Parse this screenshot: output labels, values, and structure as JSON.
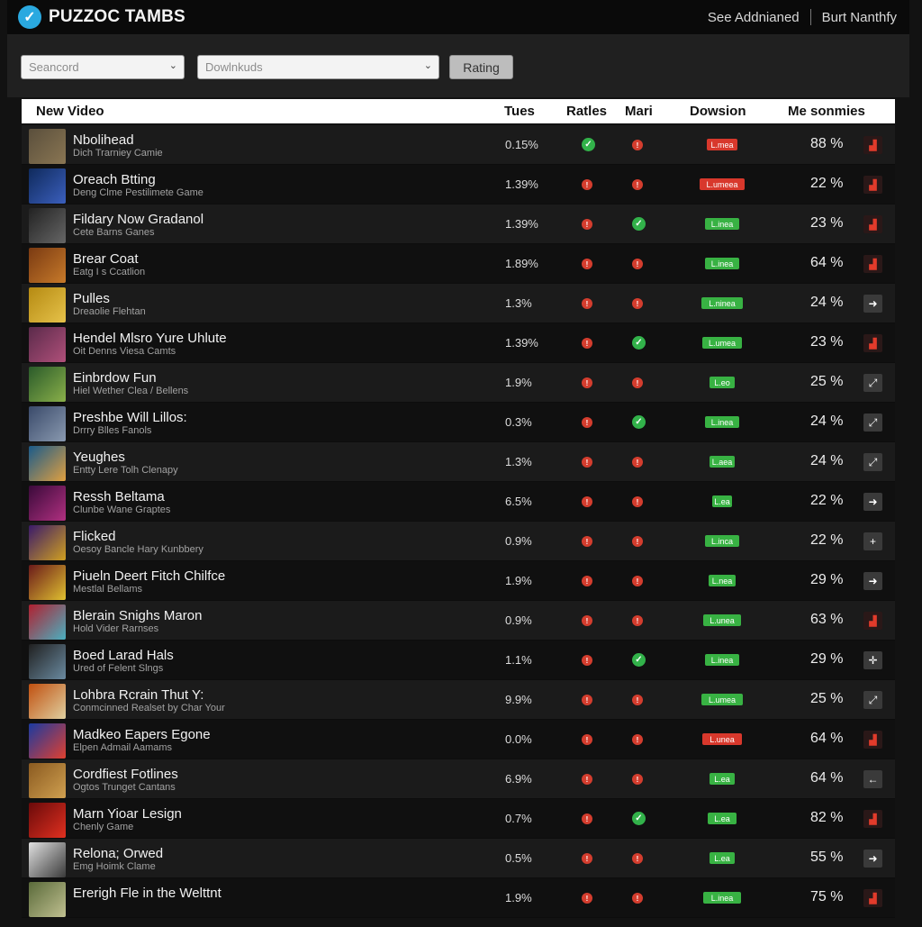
{
  "header": {
    "logo_icon": "check-badge-icon",
    "title": "PUZZOC TAMBS",
    "link_left": "See Addnianed",
    "link_right": "Burt Nanthfy"
  },
  "filters": {
    "search_value": "Seancord",
    "downloads_value": "Dowlnkuds",
    "rating_label": "Rating"
  },
  "columns": {
    "name": "New Video",
    "tues": "Tues",
    "ratles": "Ratles",
    "mari": "Mari",
    "dowsion": "Dowsion",
    "me": "Me sonmies"
  },
  "colors": {
    "accent": "#2aa9e0",
    "good": "#32b24a",
    "bad": "#d43d2e"
  },
  "rows": [
    {
      "title": "Nbolihead",
      "subtitle": "Dich Trarniey Camie",
      "tues": "0.15%",
      "ratles": "check",
      "mari": "x",
      "dowsion": "L.mea",
      "dowsion_color": "red",
      "me": "88 %",
      "action": "chart-icon",
      "thumb": [
        "#5a4f3c",
        "#8a7653"
      ]
    },
    {
      "title": "Oreach Btting",
      "subtitle": "Deng Clme Pestilimete Game",
      "tues": "1.39%",
      "ratles": "x",
      "mari": "x",
      "dowsion": "L.umeea",
      "dowsion_color": "red",
      "me": "22 %",
      "action": "chart-icon",
      "thumb": [
        "#0f2a5c",
        "#3b5fbd"
      ]
    },
    {
      "title": "Fildary Now Gradanol",
      "subtitle": "Cete Barns Ganes",
      "tues": "1.39%",
      "ratles": "x",
      "mari": "check",
      "dowsion": "L.inea",
      "dowsion_color": "green",
      "me": "23 %",
      "action": "chart-icon",
      "thumb": [
        "#222",
        "#666"
      ]
    },
    {
      "title": "Brear Coat",
      "subtitle": "Eatg I s Ccatlion",
      "tues": "1.89%",
      "ratles": "x",
      "mari": "x",
      "dowsion": "L.inea",
      "dowsion_color": "green",
      "me": "64 %",
      "action": "chart-icon",
      "thumb": [
        "#7a3a12",
        "#c77a2a"
      ]
    },
    {
      "title": "Pulles",
      "subtitle": "Dreaolie Flehtan",
      "tues": "1.3%",
      "ratles": "x",
      "mari": "x",
      "dowsion": "L.ninea",
      "dowsion_color": "green",
      "me": "24 %",
      "action": "arrow-icon",
      "thumb": [
        "#b58a12",
        "#e6c24a"
      ]
    },
    {
      "title": "Hendel Mlsro Yure Uhlute",
      "subtitle": "Oit Denns Viesa Camts",
      "tues": "1.39%",
      "ratles": "x",
      "mari": "check",
      "dowsion": "L.umea",
      "dowsion_color": "green",
      "me": "23 %",
      "action": "chart-icon",
      "thumb": [
        "#5a2a4a",
        "#b0507a"
      ]
    },
    {
      "title": "Einbrdow Fun",
      "subtitle": "Hiel Wether Clea / Bellens",
      "tues": "1.9%",
      "ratles": "x",
      "mari": "x",
      "dowsion": "L.eo",
      "dowsion_color": "green",
      "me": "25 %",
      "action": "expand-icon",
      "thumb": [
        "#2a5a2a",
        "#8ab04a"
      ]
    },
    {
      "title": "Preshbe Will Lillos:",
      "subtitle": "Drrry Blles Fanols",
      "tues": "0.3%",
      "ratles": "x",
      "mari": "check",
      "dowsion": "L.inea",
      "dowsion_color": "green",
      "me": "24 %",
      "action": "expand-icon",
      "thumb": [
        "#3a4a6a",
        "#8a9ab0"
      ]
    },
    {
      "title": "Yeughes",
      "subtitle": "Entty Lere Tolh Clenapy",
      "tues": "1.3%",
      "ratles": "x",
      "mari": "x",
      "dowsion": "L.aea",
      "dowsion_color": "green",
      "me": "24 %",
      "action": "expand-icon",
      "thumb": [
        "#1a5a8a",
        "#e0a040"
      ]
    },
    {
      "title": "Ressh Beltama",
      "subtitle": "Clunbe Wane Graptes",
      "tues": "6.5%",
      "ratles": "x",
      "mari": "x",
      "dowsion": "L.ea",
      "dowsion_color": "green",
      "me": "22 %",
      "action": "arrow-icon",
      "thumb": [
        "#3a0a3a",
        "#b03080"
      ]
    },
    {
      "title": "Flicked",
      "subtitle": "Oesoy Bancle Hary Kunbbery",
      "tues": "0.9%",
      "ratles": "x",
      "mari": "x",
      "dowsion": "L.inca",
      "dowsion_color": "green",
      "me": "22 %",
      "action": "plus-icon",
      "thumb": [
        "#3a1a6a",
        "#d0a020"
      ]
    },
    {
      "title": "Piueln Deert Fitch Chilfce",
      "subtitle": "Mestlal Bellams",
      "tues": "1.9%",
      "ratles": "x",
      "mari": "x",
      "dowsion": "L.nea",
      "dowsion_color": "green",
      "me": "29 %",
      "action": "arrow-icon",
      "thumb": [
        "#6a1a1a",
        "#e0c030"
      ]
    },
    {
      "title": "Blerain Snighs Maron",
      "subtitle": "Hold Vider Rarnses",
      "tues": "0.9%",
      "ratles": "x",
      "mari": "x",
      "dowsion": "L.unea",
      "dowsion_color": "green",
      "me": "63 %",
      "action": "chart-icon",
      "thumb": [
        "#b02030",
        "#4ab0c0"
      ]
    },
    {
      "title": "Boed Larad Hals",
      "subtitle": "Ured of Felent Slngs",
      "tues": "1.1%",
      "ratles": "x",
      "mari": "check",
      "dowsion": "L.inea",
      "dowsion_color": "green",
      "me": "29 %",
      "action": "cross-icon",
      "thumb": [
        "#202020",
        "#6a8aa0"
      ]
    },
    {
      "title": "Lohbra Rcrain Thut Y:",
      "subtitle": "Conmcinned Realset by Char Your",
      "tues": "9.9%",
      "ratles": "x",
      "mari": "x",
      "dowsion": "L.umea",
      "dowsion_color": "green",
      "me": "25 %",
      "action": "expand-icon",
      "thumb": [
        "#c05010",
        "#e0d0a0"
      ]
    },
    {
      "title": "Madkeo Eapers Egone",
      "subtitle": "Elpen Admail Aamams",
      "tues": "0.0%",
      "ratles": "x",
      "mari": "x",
      "dowsion": "L.unea",
      "dowsion_color": "red",
      "me": "64 %",
      "action": "chart-icon",
      "thumb": [
        "#1a3aa0",
        "#e04030"
      ]
    },
    {
      "title": "Cordfiest Fotlines",
      "subtitle": "Ogtos Trunget Cantans",
      "tues": "6.9%",
      "ratles": "x",
      "mari": "x",
      "dowsion": "L.ea",
      "dowsion_color": "green",
      "me": "64 %",
      "action": "back-icon",
      "thumb": [
        "#8a5a20",
        "#d0a050"
      ]
    },
    {
      "title": "Marn Yioar Lesign",
      "subtitle": "Chenly Game",
      "tues": "0.7%",
      "ratles": "x",
      "mari": "check",
      "dowsion": "L.ea",
      "dowsion_color": "green",
      "me": "82 %",
      "action": "chart-icon",
      "thumb": [
        "#6a0a0a",
        "#e03020"
      ]
    },
    {
      "title": "Relona; Orwed",
      "subtitle": "Emg Hoimk Clame",
      "tues": "0.5%",
      "ratles": "x",
      "mari": "x",
      "dowsion": "L.ea",
      "dowsion_color": "green",
      "me": "55 %",
      "action": "arrow-icon",
      "thumb": [
        "#e0e0e0",
        "#3a3a3a"
      ]
    },
    {
      "title": "Ererigh Fle in the Welttnt",
      "subtitle": "",
      "tues": "1.9%",
      "ratles": "x",
      "mari": "x",
      "dowsion": "L.inea",
      "dowsion_color": "green",
      "me": "75 %",
      "action": "chart-icon",
      "thumb": [
        "#5a6a3a",
        "#c0c090"
      ]
    }
  ]
}
